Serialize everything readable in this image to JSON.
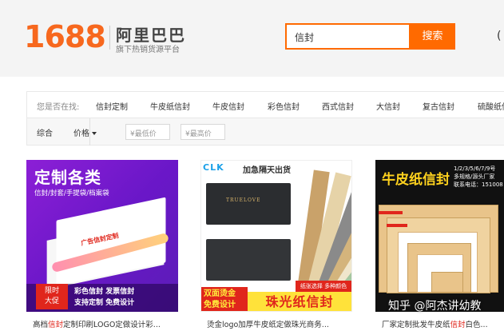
{
  "header": {
    "logo_num": "1688",
    "logo_cn": "阿里巴巴",
    "logo_sub": "旗下热销货源平台",
    "right_fragment": "("
  },
  "search": {
    "value": "信封",
    "button_label": "搜索"
  },
  "suggestions": {
    "label": "您是否在找:",
    "items": [
      "信封定制",
      "牛皮纸信封",
      "牛皮信封",
      "彩色信封",
      "西式信封",
      "大信封",
      "复古信封",
      "硫酸纸信"
    ]
  },
  "filters": {
    "tab_all": "综合",
    "tab_price": "价格",
    "min_placeholder": "¥最低价",
    "max_placeholder": "¥最高价",
    "dash": "-"
  },
  "products": [
    {
      "title_pre": "高档",
      "title_hl": "信封",
      "title_post": "定制印刷LOGO定做设计彩...",
      "image": {
        "headline": "定制各类",
        "subline": "信封/封套/手提袋/档案袋",
        "paper_title": "广告信封定制",
        "badge": "限时\n大促",
        "promo1": "彩色信封  发票信封",
        "promo2": "支持定制  免费设计"
      }
    },
    {
      "title_pre": "烫金logo加厚牛皮纸定做珠光商务...",
      "title_hl": "",
      "title_post": "",
      "image": {
        "brand": "CLK",
        "top_text": "加急隔天出货",
        "env_label": "TRUELOVE",
        "strip_text": "纸张选择 多种颜色",
        "left_text": "双面烫金\n免费设计",
        "right_text": "珠光纸信封"
      }
    },
    {
      "title_pre": "厂家定制批发牛皮纸",
      "title_hl": "信封",
      "title_post": "白色...",
      "image": {
        "headline": "牛皮纸信封",
        "info": "1/2/3/5/6/7/9号\n多规格/源头厂家\n联系电话：151008"
      }
    }
  ],
  "watermark": "知乎 @阿杰讲幼教"
}
